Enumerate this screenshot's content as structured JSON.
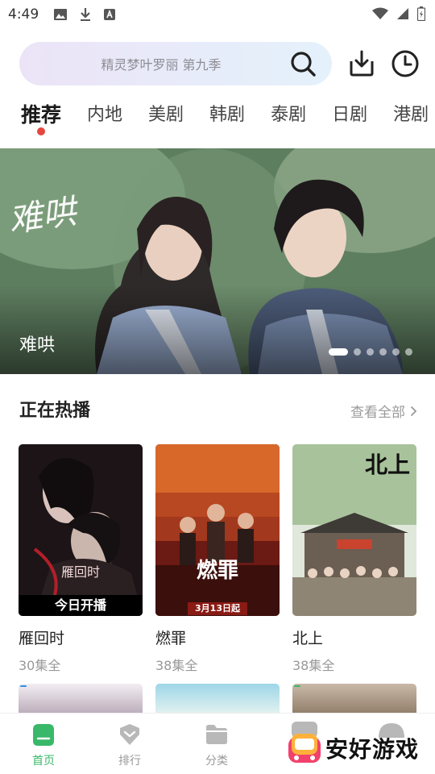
{
  "status_bar": {
    "time": "4:49"
  },
  "search": {
    "placeholder": "精灵梦叶罗丽 第九季"
  },
  "tabs": [
    {
      "label": "推荐",
      "active": true
    },
    {
      "label": "内地",
      "active": false
    },
    {
      "label": "美剧",
      "active": false
    },
    {
      "label": "韩剧",
      "active": false
    },
    {
      "label": "泰剧",
      "active": false
    },
    {
      "label": "日剧",
      "active": false
    },
    {
      "label": "港剧",
      "active": false
    }
  ],
  "banner": {
    "title": "难哄",
    "calligraphy": "难哄",
    "slide_count": 6,
    "active_slide": 1
  },
  "section": {
    "title": "正在热播",
    "see_all": "查看全部"
  },
  "cards": [
    {
      "title": "雁回时",
      "subtitle": "30集全",
      "poster_label": "今日开播",
      "poster_text": "雁回时"
    },
    {
      "title": "燃罪",
      "subtitle": "38集全",
      "poster_label": "3月13日起",
      "poster_text": "燃罪"
    },
    {
      "title": "北上",
      "subtitle": "38集全",
      "poster_label": "",
      "poster_text": "北上"
    }
  ],
  "bottom_nav": [
    {
      "label": "首页",
      "icon": "home-icon",
      "active": true
    },
    {
      "label": "排行",
      "icon": "heart-icon",
      "active": false
    },
    {
      "label": "分类",
      "icon": "folder-icon",
      "active": false
    }
  ],
  "watermark": {
    "text": "安好游戏"
  },
  "colors": {
    "accent_green": "#3ab86a",
    "tab_dot_red": "#e5473f",
    "banner_dot_white": "#ffffff"
  }
}
